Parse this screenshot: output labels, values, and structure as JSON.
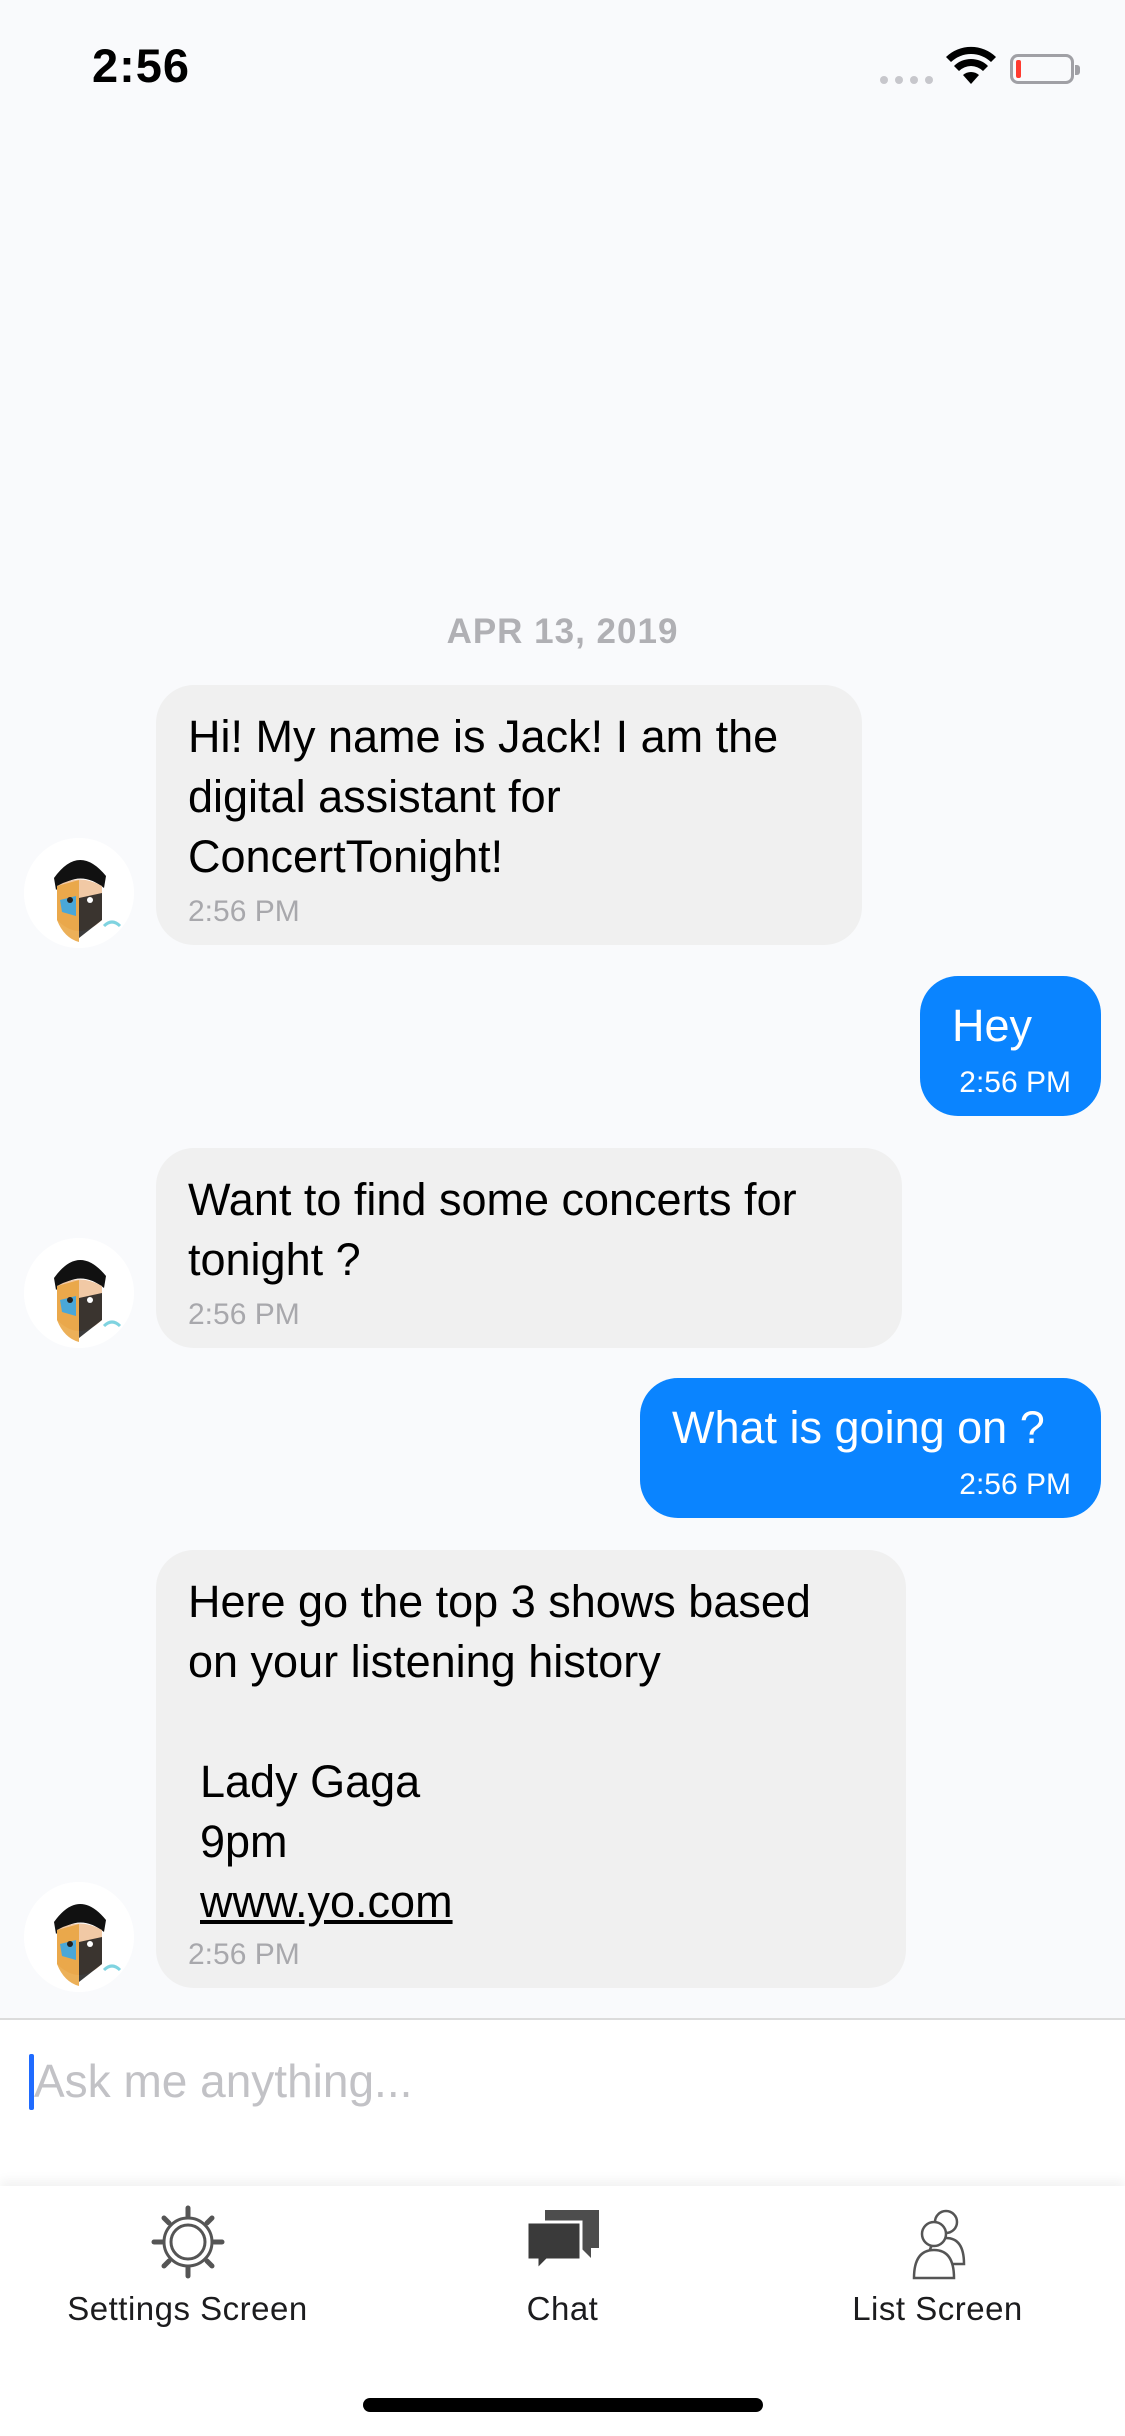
{
  "status_bar": {
    "time": "2:56"
  },
  "chat": {
    "date_header": "APR 13, 2019",
    "messages": [
      {
        "side": "left",
        "text": "Hi! My name is Jack! I am the\ndigital assistant for\nConcertTonight!",
        "time": "2:56 PM"
      },
      {
        "side": "right",
        "text": "Hey",
        "time": "2:56 PM"
      },
      {
        "side": "left",
        "text": "Want to find some concerts for\ntonight ?",
        "time": "2:56 PM"
      },
      {
        "side": "right",
        "text": "What is going on ?",
        "time": "2:56 PM"
      },
      {
        "side": "left",
        "text": "Here go the top 3 shows based\non your listening history",
        "list_artist": "Lady Gaga",
        "list_time": "9pm",
        "list_link": "www.yo.com",
        "time": "2:56 PM"
      }
    ]
  },
  "composer": {
    "placeholder": "Ask me anything...",
    "value": ""
  },
  "tab_bar": {
    "tabs": [
      {
        "label": "Settings Screen",
        "icon": "gear-icon"
      },
      {
        "label": "Chat",
        "icon": "chat-bubbles-icon"
      },
      {
        "label": "List Screen",
        "icon": "people-icon"
      }
    ]
  },
  "colors": {
    "outgoing_bubble": "#0a84ff",
    "incoming_bubble": "#f0f0f0",
    "background": "#f9fafc"
  }
}
